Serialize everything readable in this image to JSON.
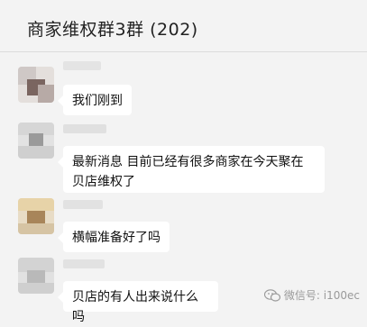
{
  "header": {
    "title": "商家维权群3群 (202)"
  },
  "messages": [
    {
      "text": "我们刚到"
    },
    {
      "text": "最新消息 目前已经有很多商家在今天聚在贝店维权了"
    },
    {
      "text": "横幅准备好了吗"
    },
    {
      "text": "贝店的有人出来说什么吗"
    }
  ],
  "watermark": {
    "text": "微信号: i100ec",
    "icon": "wechat-icon"
  }
}
